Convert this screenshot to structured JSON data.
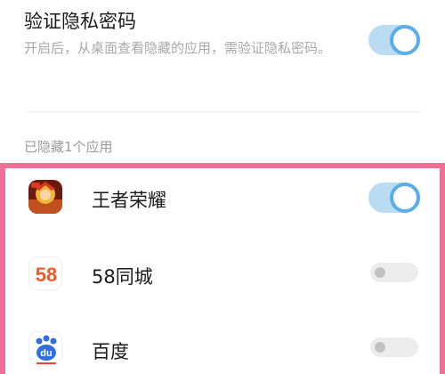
{
  "verify": {
    "title": "验证隐私密码",
    "description": "开启后，从桌面查看隐藏的应用，需验证隐私密码。",
    "enabled": true
  },
  "hidden_section": {
    "label": "已隐藏1个应用"
  },
  "apps": [
    {
      "name": "王者荣耀",
      "icon": "honor-of-kings-icon",
      "hidden": true
    },
    {
      "name": "58同城",
      "icon": "58-icon",
      "hidden": false,
      "icon_text": "58"
    },
    {
      "name": "百度",
      "icon": "baidu-paw-icon",
      "hidden": false,
      "icon_text": "du"
    }
  ],
  "colors": {
    "accent": "#5aaee8",
    "toggle_on_track": "#b9dcf3",
    "highlight_border": "#ef6f97"
  }
}
